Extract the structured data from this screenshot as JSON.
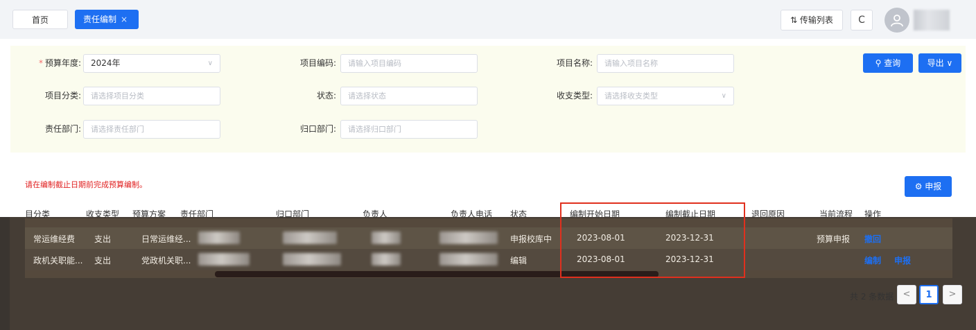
{
  "tabs": {
    "home": "首页",
    "active": "责任编制",
    "active_close": "×"
  },
  "topbar": {
    "transfer_label": "⇅ 传输列表",
    "refresh_glyph": "C"
  },
  "filters": {
    "budget_year_label": "预算年度:",
    "budget_year_value": "2024年",
    "project_code_label": "项目编码:",
    "project_code_placeholder": "请输入项目编码",
    "project_name_label": "项目名称:",
    "project_name_placeholder": "请输入项目名称",
    "project_category_label": "项目分类:",
    "project_category_placeholder": "请选择项目分类",
    "status_label": "状态:",
    "status_placeholder": "请选择状态",
    "income_type_label": "收支类型:",
    "income_type_placeholder": "请选择收支类型",
    "resp_dept_label": "责任部门:",
    "resp_dept_placeholder": "请选择责任部门",
    "belong_dept_label": "归口部门:",
    "belong_dept_placeholder": "请选择归口部门",
    "query_label": "查询",
    "export_label": "导出"
  },
  "notice": "请在编制截止日期前完成预算编制。",
  "report_label": "申报",
  "table": {
    "headers": [
      "目分类",
      "收支类型",
      "预算方案",
      "责任部门",
      "归口部门",
      "负责人",
      "负责人电话",
      "状态",
      "编制开始日期",
      "编制截止日期",
      "退回原因",
      "当前流程",
      "操作"
    ],
    "rows": [
      {
        "category": "常运维经费",
        "type": "支出",
        "plan": "日常运维经...",
        "status": "申报校库中",
        "start": "2023-08-01",
        "end": "2023-12-31",
        "reason": "",
        "flow": "预算申报",
        "op1": "撤回",
        "op2": ""
      },
      {
        "category": "政机关职能...",
        "type": "支出",
        "plan": "党政机关职...",
        "status": "编辑",
        "start": "2023-08-01",
        "end": "2023-12-31",
        "reason": "",
        "flow": "",
        "op1": "编制",
        "op2": "申报"
      }
    ]
  },
  "pager": {
    "total": "共 2 条数据",
    "prev": "<",
    "current": "1",
    "next": ">"
  },
  "colors": {
    "primary": "#1d6ff2",
    "notice": "#e02020",
    "highlight_box": "#e0301e",
    "filter_bg": "#fbfcee"
  }
}
